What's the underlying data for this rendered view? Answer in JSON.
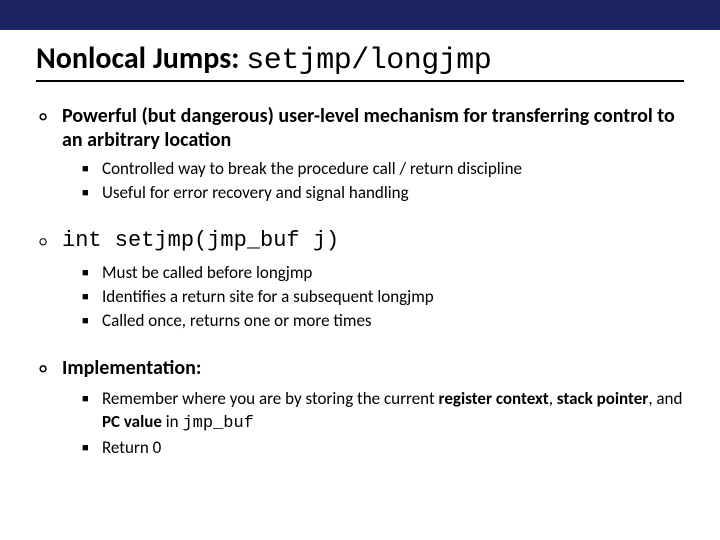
{
  "title": {
    "prefix": "Nonlocal Jumps: ",
    "code": "setjmp/longjmp"
  },
  "sections": [
    {
      "heading_html": "Powerful (but dangerous) user-level mechanism for transferring control to an arbitrary location",
      "heading_is_code": false,
      "subs": [
        "Controlled way to break the procedure call / return discipline",
        "Useful for error recovery and signal handling"
      ]
    },
    {
      "heading_html": "int setjmp(jmp_buf j)",
      "heading_is_code": true,
      "subs": [
        "Must be called before longjmp",
        "Identifies a return site for a subsequent longjmp",
        "Called once, returns one or more times"
      ]
    },
    {
      "heading_html": "Implementation:",
      "heading_is_code": false,
      "subs": [
        "Remember where you are by storing  the current <span class=\"bold\">register context</span>, <span class=\"bold\">stack pointer</span>,  and <span class=\"bold\">PC value</span> in <span class=\"mono\">jmp_buf</span>",
        "Return 0"
      ]
    }
  ]
}
